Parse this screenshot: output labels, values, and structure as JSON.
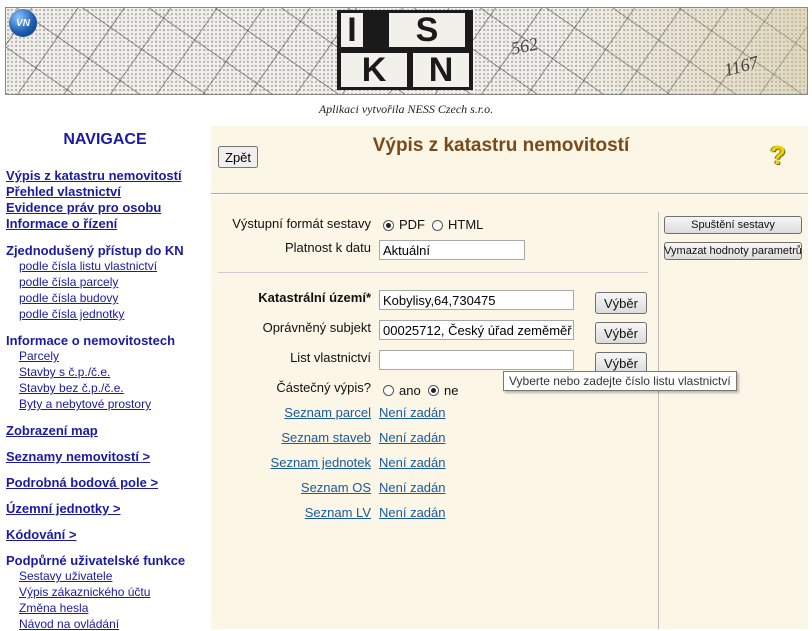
{
  "header": {
    "credit": "Aplikaci vytvořila NESS Czech s.r.o.",
    "logo_letters": [
      "I",
      "S",
      "K",
      "N"
    ],
    "vn_logo_text": "VN",
    "map_numbers": [
      "562",
      "1167"
    ]
  },
  "nav": {
    "title": "NAVIGACE",
    "links": [
      "Výpis z katastru nemovitostí",
      "Přehled vlastnictví",
      "Evidence práv pro osobu",
      "Informace o řízení"
    ],
    "simplified_access": {
      "heading": "Zjednodušený přístup do KN",
      "items": [
        "podle čísla listu vlastnictví",
        "podle čísla parcely",
        "podle čísla budovy",
        "podle čísla jednotky"
      ]
    },
    "property_info": {
      "heading": "Informace o nemovitostech",
      "items": [
        "Parcely",
        "Stavby s č.p./č.e.",
        "Stavby bez č.p./č.e.",
        "Byty a nebytové prostory"
      ]
    },
    "map_display": "Zobrazení map",
    "property_lists": "Seznamy nemovitostí >",
    "survey_points": "Podrobná bodová pole >",
    "territorial_units": "Územní jednotky >",
    "coding": "Kódování >",
    "user_functions": {
      "heading": "Podpůrné uživatelské funkce",
      "items": [
        "Sestavy uživatele",
        "Výpis zákaznického účtu",
        "Změna hesla",
        "Návod na ovládání"
      ]
    }
  },
  "main": {
    "back_button": "Zpět",
    "title": "Výpis z katastru nemovitostí",
    "help_icon": "?",
    "format": {
      "label": "Výstupní formát sestavy",
      "options": [
        "PDF",
        "HTML"
      ],
      "selected": "PDF"
    },
    "validity": {
      "label": "Platnost k datu",
      "value": "Aktuální"
    },
    "cadastral_area": {
      "label": "Katastrální území*",
      "value": "Kobylisy,64,730475",
      "button": "Výběr"
    },
    "authorized_subject": {
      "label": "Oprávněný subjekt",
      "value": "00025712, Český úřad zeměměř",
      "button": "Výběr"
    },
    "ownership_sheet": {
      "label": "List vlastnictví",
      "value": "",
      "button": "Výběr"
    },
    "tooltip": "Vyberte nebo zadejte číslo listu vlastnictví",
    "partial_extract": {
      "label": "Částečný výpis?",
      "options": [
        "ano",
        "ne"
      ],
      "selected": "ne"
    },
    "lists": [
      {
        "label": "Seznam parcel",
        "value": "Není zadán"
      },
      {
        "label": "Seznam staveb",
        "value": "Není zadán"
      },
      {
        "label": "Seznam jednotek",
        "value": "Není zadán"
      },
      {
        "label": "Seznam OS",
        "value": "Není zadán"
      },
      {
        "label": "Seznam LV",
        "value": "Není zadán"
      }
    ],
    "run_button": "Spuštění sestavy",
    "clear_button": "Vymazat hodnoty parametrů"
  }
}
